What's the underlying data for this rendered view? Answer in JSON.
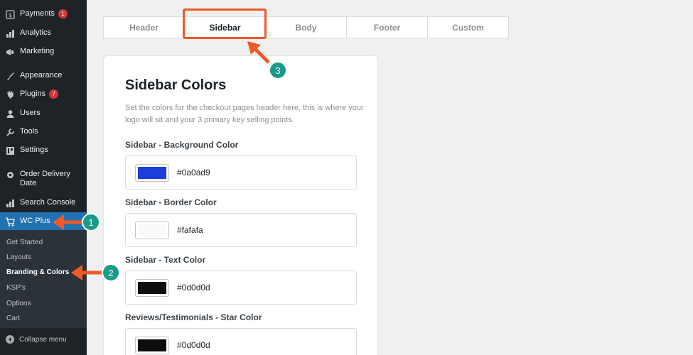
{
  "sidebar": {
    "menu": [
      {
        "label": "Payments",
        "icon": "payments-icon",
        "badge": "1"
      },
      {
        "label": "Analytics",
        "icon": "analytics-icon"
      },
      {
        "label": "Marketing",
        "icon": "megaphone-icon"
      },
      {
        "label": "Appearance",
        "icon": "brush-icon"
      },
      {
        "label": "Plugins",
        "icon": "plugin-icon",
        "badge": "7"
      },
      {
        "label": "Users",
        "icon": "user-icon"
      },
      {
        "label": "Tools",
        "icon": "wrench-icon"
      },
      {
        "label": "Settings",
        "icon": "settings-icon"
      },
      {
        "label": "Order Delivery Date",
        "icon": "gear-icon"
      },
      {
        "label": "Search Console",
        "icon": "bar-chart-icon"
      },
      {
        "label": "WC Plus",
        "icon": "cart-icon"
      }
    ],
    "submenu": [
      "Get Started",
      "Layouts",
      "Branding & Colors",
      "KSP's",
      "Options",
      "Cart"
    ],
    "collapse_label": "Collapse menu"
  },
  "tabs": [
    "Header",
    "Sidebar",
    "Body",
    "Footer",
    "Custom"
  ],
  "active_tab": "Sidebar",
  "card": {
    "title": "Sidebar Colors",
    "description": "Set the colors for the checkout pages header here, this is where your logo will sit and your 3 primary key selling points.",
    "fields": [
      {
        "label": "Sidebar - Background Color",
        "value": "#0a0ad9",
        "color": "#1d3fd9"
      },
      {
        "label": "Sidebar - Border Color",
        "value": "#fafafa",
        "color": "#fafafa"
      },
      {
        "label": "Sidebar - Text Color",
        "value": "#0d0d0d",
        "color": "#0d0d0d"
      },
      {
        "label": "Reviews/Testimonials - Star Color",
        "value": "#0d0d0d",
        "color": "#0d0d0d"
      }
    ]
  },
  "annotations": [
    "1",
    "2",
    "3"
  ],
  "colors": {
    "accent": "#f05a28",
    "marker": "#1a9b8a",
    "wp_blue": "#2271b1",
    "sidebar_bg": "#1d2327"
  }
}
